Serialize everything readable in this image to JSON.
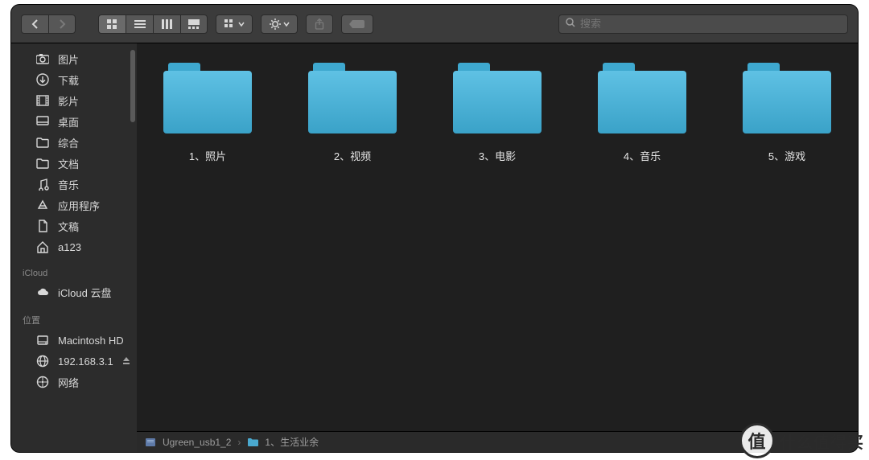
{
  "search": {
    "placeholder": "搜索"
  },
  "sidebar": {
    "favorites": [
      {
        "label": "图片",
        "icon": "camera"
      },
      {
        "label": "下载",
        "icon": "download"
      },
      {
        "label": "影片",
        "icon": "film"
      },
      {
        "label": "桌面",
        "icon": "desktop"
      },
      {
        "label": "综合",
        "icon": "folder"
      },
      {
        "label": "文档",
        "icon": "folder"
      },
      {
        "label": "音乐",
        "icon": "music"
      },
      {
        "label": "应用程序",
        "icon": "apps"
      },
      {
        "label": "文稿",
        "icon": "doc"
      },
      {
        "label": "a123",
        "icon": "home"
      }
    ],
    "icloud_heading": "iCloud",
    "icloud": [
      {
        "label": "iCloud 云盘",
        "icon": "cloud"
      }
    ],
    "locations_heading": "位置",
    "locations": [
      {
        "label": "Macintosh HD",
        "icon": "disk",
        "eject": false
      },
      {
        "label": "192.168.3.1",
        "icon": "globe",
        "eject": true
      },
      {
        "label": "网络",
        "icon": "network",
        "eject": false
      }
    ]
  },
  "folders": [
    {
      "label": "1、照片"
    },
    {
      "label": "2、视频"
    },
    {
      "label": "3、电影"
    },
    {
      "label": "4、音乐"
    },
    {
      "label": "5、游戏"
    }
  ],
  "pathbar": {
    "root": "Ugreen_usb1_2",
    "current": "1、生活业余"
  },
  "watermark": {
    "badge": "值",
    "text": "什么值得买"
  }
}
